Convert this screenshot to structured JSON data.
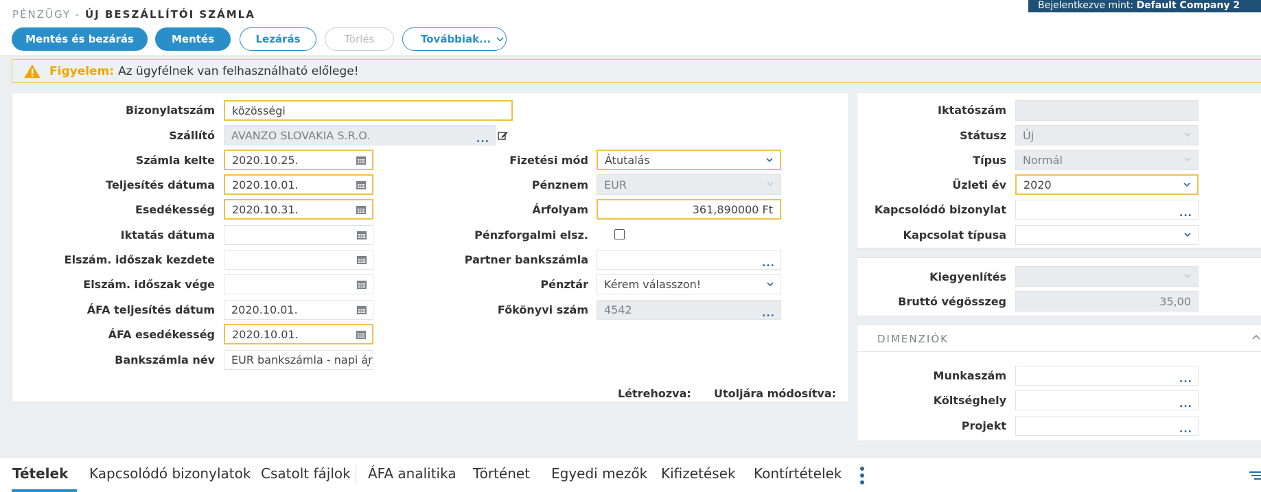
{
  "header": {
    "module": "PÉNZÜGY - ",
    "title": "ÚJ BESZÁLLÍTÓI SZÁMLA",
    "login_prefix": "Bejelentkezve mint: ",
    "login_user": "Default Company 2"
  },
  "toolbar": {
    "save_close": "Mentés és bezárás",
    "save": "Mentés",
    "close": "Lezárás",
    "delete": "Törlés",
    "more": "Továbbiak..."
  },
  "warning": {
    "label": "Figyelem:",
    "text": "Az ügyfélnek van felhasználható előlege!"
  },
  "form_left": {
    "doc_number_label": "Bizonylatszám",
    "doc_number_value": "közösségi",
    "supplier_label": "Szállító",
    "supplier_value": "AVANZO SLOVAKIA S.R.O.",
    "invoice_date_label": "Számla kelte",
    "invoice_date_value": "2020.10.25.",
    "fulfillment_date_label": "Teljesítés dátuma",
    "fulfillment_date_value": "2020.10.01.",
    "due_date_label": "Esedékesség",
    "due_date_value": "2020.10.31.",
    "filing_date_label": "Iktatás dátuma",
    "filing_date_value": "",
    "period_start_label": "Elszám. időszak kezdete",
    "period_start_value": "",
    "period_end_label": "Elszám. időszak vége",
    "period_end_value": "",
    "vat_fulfillment_label": "ÁFA teljesítés dátum",
    "vat_fulfillment_value": "2020.10.01.",
    "vat_due_label": "ÁFA esedékesség",
    "vat_due_value": "2020.10.01.",
    "bank_account_label": "Bankszámla név",
    "bank_account_value": "EUR bankszámla - napi árf"
  },
  "form_mid": {
    "payment_method_label": "Fizetési mód",
    "payment_method_value": "Átutalás",
    "currency_label": "Pénznem",
    "currency_value": "EUR",
    "rate_label": "Árfolyam",
    "rate_value": "361,890000 Ft",
    "cash_accounting_label": "Pénzforgalmi elsz.",
    "partner_account_label": "Partner bankszámla",
    "partner_account_value": "",
    "cashdesk_label": "Pénztár",
    "cashdesk_value": "Kérem válasszon!",
    "ledger_label": "Főkönyvi szám",
    "ledger_value": "4542",
    "created_label": "Létrehozva:",
    "modified_label": "Utoljára módosítva:"
  },
  "form_right": {
    "filing_number_label": "Iktatószám",
    "filing_number_value": "",
    "status_label": "Státusz",
    "status_value": "Új",
    "type_label": "Típus",
    "type_value": "Normál",
    "business_year_label": "Üzleti év",
    "business_year_value": "2020",
    "related_doc_label": "Kapcsolódó bizonylat",
    "related_doc_value": "",
    "relation_type_label": "Kapcsolat típusa",
    "relation_type_value": ""
  },
  "settlement": {
    "settlement_label": "Kiegyenlítés",
    "settlement_value": "",
    "gross_total_label": "Bruttó végösszeg",
    "gross_total_value": "35,00"
  },
  "dimensions": {
    "title": "DIMENZIÓK",
    "work_number_label": "Munkaszám",
    "work_number_value": "",
    "cost_center_label": "Költséghely",
    "cost_center_value": "",
    "project_label": "Projekt",
    "project_value": ""
  },
  "tabs": [
    {
      "label": "Tételek"
    },
    {
      "label": "Kapcsolódó bizonylatok"
    },
    {
      "label": "Csatolt fájlok"
    },
    {
      "label": "ÁFA analitika"
    },
    {
      "label": "Történet"
    },
    {
      "label": "Egyedi mezők"
    },
    {
      "label": "Kifizetések"
    },
    {
      "label": "Kontírtételek"
    }
  ],
  "colors": {
    "primary": "#2a8fc9",
    "warning": "#f0a500",
    "highlight_border": "#f0c14b",
    "banner": "#1e4f74"
  }
}
